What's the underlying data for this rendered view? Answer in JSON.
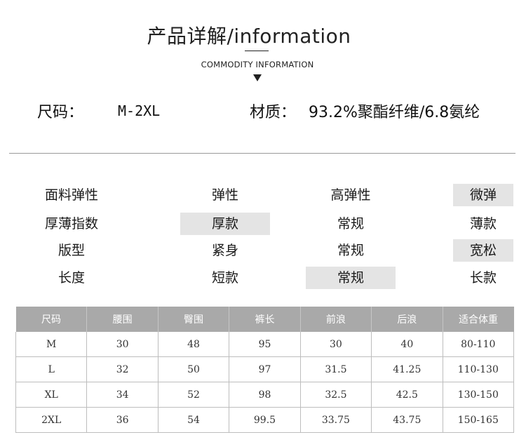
{
  "header": {
    "title": "产品详解/information",
    "subtitle": "COMMODITY INFORMATION"
  },
  "specs": {
    "size_label": "尺码：",
    "size_value": "M-2XL",
    "material_label": "材质：",
    "material_value": "93.2%聚酯纤维/6.8氨纶"
  },
  "attributes": [
    {
      "name": "面料弹性",
      "options": [
        "弹性",
        "高弹性",
        "微弹"
      ],
      "selected": 2
    },
    {
      "name": "厚薄指数",
      "options": [
        "厚款",
        "常规",
        "薄款"
      ],
      "selected": 0
    },
    {
      "name": "版型",
      "options": [
        "紧身",
        "常规",
        "宽松"
      ],
      "selected": 2
    },
    {
      "name": "长度",
      "options": [
        "短款",
        "常规",
        "长款"
      ],
      "selected": 1
    }
  ],
  "size_table": {
    "headers": [
      "尺码",
      "腰围",
      "臀围",
      "裤长",
      "前浪",
      "后浪",
      "适合体重"
    ],
    "rows": [
      [
        "M",
        "30",
        "48",
        "95",
        "30",
        "40",
        "80-110"
      ],
      [
        "L",
        "32",
        "50",
        "97",
        "31.5",
        "41.25",
        "110-130"
      ],
      [
        "XL",
        "34",
        "52",
        "98",
        "32.5",
        "42.5",
        "130-150"
      ],
      [
        "2XL",
        "36",
        "54",
        "99.5",
        "33.75",
        "43.75",
        "150-165"
      ]
    ]
  },
  "colors": {
    "highlight": "#e4e4e4",
    "table_header": "#a9a9a9",
    "divider": "#9a9a9a"
  },
  "icons": {
    "title_marker": "triangle-down-icon"
  }
}
